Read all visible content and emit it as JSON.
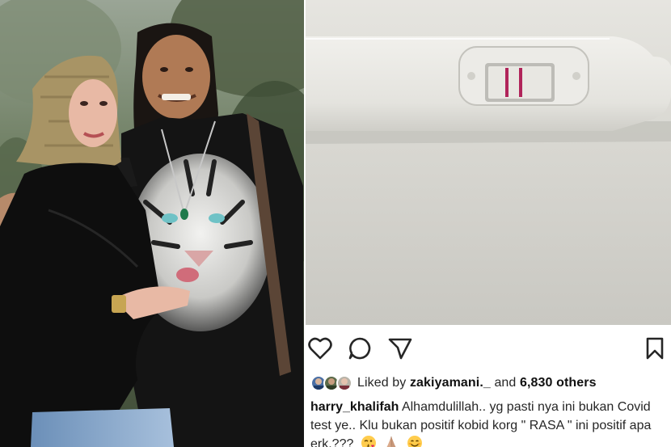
{
  "post": {
    "actions": {
      "like_icon": "heart-outline",
      "comment_icon": "speech-bubble",
      "share_icon": "paper-plane",
      "save_icon": "bookmark-outline"
    },
    "likes": {
      "prefix": "Liked by",
      "first_user": "zakiyamani._",
      "joiner": "and",
      "others": "6,830 others"
    },
    "caption": {
      "username": "harry_khalifah",
      "text": "Alhamdulillah.. yg pasti nya ini bukan Covid test ye.. Klu bukan positif kobid korg \" RASA \" ini positif apa erk.???",
      "emojis": [
        "face-blowing-kiss",
        "folded-hands",
        "smiling-face"
      ]
    }
  },
  "colors": {
    "text": "#262626",
    "icon": "#262626",
    "test_line": "#b0245a",
    "background": "#ffffff"
  }
}
